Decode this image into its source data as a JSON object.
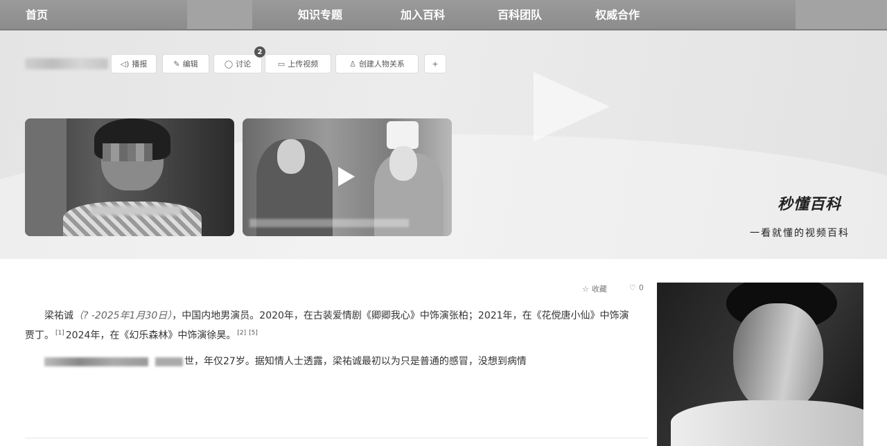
{
  "nav": {
    "home": "首页",
    "items": [
      "知识专题",
      "加入百科",
      "百科团队",
      "权威合作"
    ]
  },
  "toolbar": {
    "play": "播报",
    "edit": "编辑",
    "discuss": "讨论",
    "discuss_count": "2",
    "upload": "上传视频",
    "relation": "创建人物关系",
    "add": "+"
  },
  "banner": {
    "brand": "秒懂百科",
    "slogan": "一看就懂的视频百科"
  },
  "article": {
    "favorite": "收藏",
    "share_count": "0",
    "p1_name": "梁祐诚",
    "p1_life": "（? -2025年1月30日）",
    "p1_text_a": "，中国内地男演员。2020年，在古装爱情剧《卿卿我心》中饰演张柏；2021年，在《花傥唐小仙》中饰演贾丁。",
    "ref1": "[1]",
    "p1_text_b": "2024年，在《幻乐森林》中饰演徐昊。",
    "ref2": "[2]",
    "ref3": "[5]",
    "p2_text": "世，年仅27岁。据知情人士透露，梁祐诚最初以为只是普通的感冒，没想到病情"
  }
}
